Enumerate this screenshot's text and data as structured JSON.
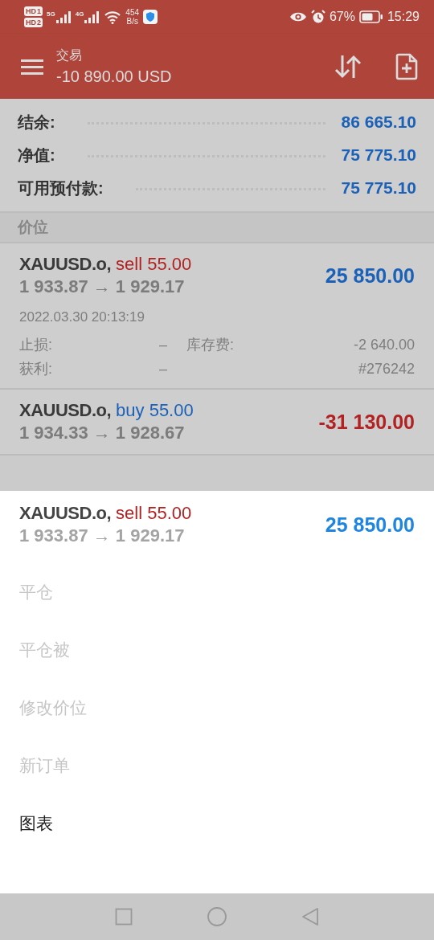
{
  "status_bar": {
    "sims": [
      {
        "label": "HD",
        "slot": "1"
      },
      {
        "label": "HD",
        "slot": "2"
      }
    ],
    "signals": [
      {
        "label": "5G"
      },
      {
        "label": "4G"
      }
    ],
    "speed": {
      "value": "454",
      "unit": "B/s"
    },
    "battery": "67%",
    "time": "15:29"
  },
  "app_bar": {
    "title": "交易",
    "subtitle": "-10 890.00 USD"
  },
  "summary": [
    {
      "label": "结余:",
      "value": "86 665.10"
    },
    {
      "label": "净值:",
      "value": "75 775.10"
    },
    {
      "label": "可用预付款:",
      "value": "75 775.10"
    }
  ],
  "section_header": "价位",
  "positions": [
    {
      "symbol": "XAUUSD.o,",
      "action": {
        "text": "sell 55.00",
        "color": "#b32222"
      },
      "prices": "1 933.87 → 1 929.17",
      "profit": {
        "text": "25 850.00",
        "color": "#1b61b8"
      },
      "expanded": true,
      "time": "2022.03.30 20:13:19",
      "details": [
        {
          "label": "止损:",
          "value": "–",
          "label_2": "库存费:",
          "value_2": "-2 640.00"
        },
        {
          "label": "获利:",
          "value": "–",
          "value_2": "#276242"
        }
      ]
    },
    {
      "symbol": "XAUUSD.o,",
      "action": {
        "text": "buy 55.00",
        "color": "#1b61b8"
      },
      "prices": "1 934.33 → 1 928.67",
      "profit": {
        "text": "-31 130.00",
        "color": "#b32222"
      },
      "expanded": false
    }
  ],
  "sheet": {
    "position": {
      "symbol": "XAUUSD.o,",
      "action": {
        "text": "sell 55.00",
        "color": "#b32222"
      },
      "prices": "1 933.87 → 1 929.17",
      "profit": {
        "text": "25 850.00",
        "color": "#1e86e0"
      }
    },
    "menu": [
      {
        "label": "平仓",
        "disabled": true
      },
      {
        "label": "平仓被",
        "disabled": true
      },
      {
        "label": "修改价位",
        "disabled": true
      },
      {
        "label": "新订单",
        "disabled": true
      },
      {
        "label": "图表",
        "disabled": false
      }
    ]
  }
}
